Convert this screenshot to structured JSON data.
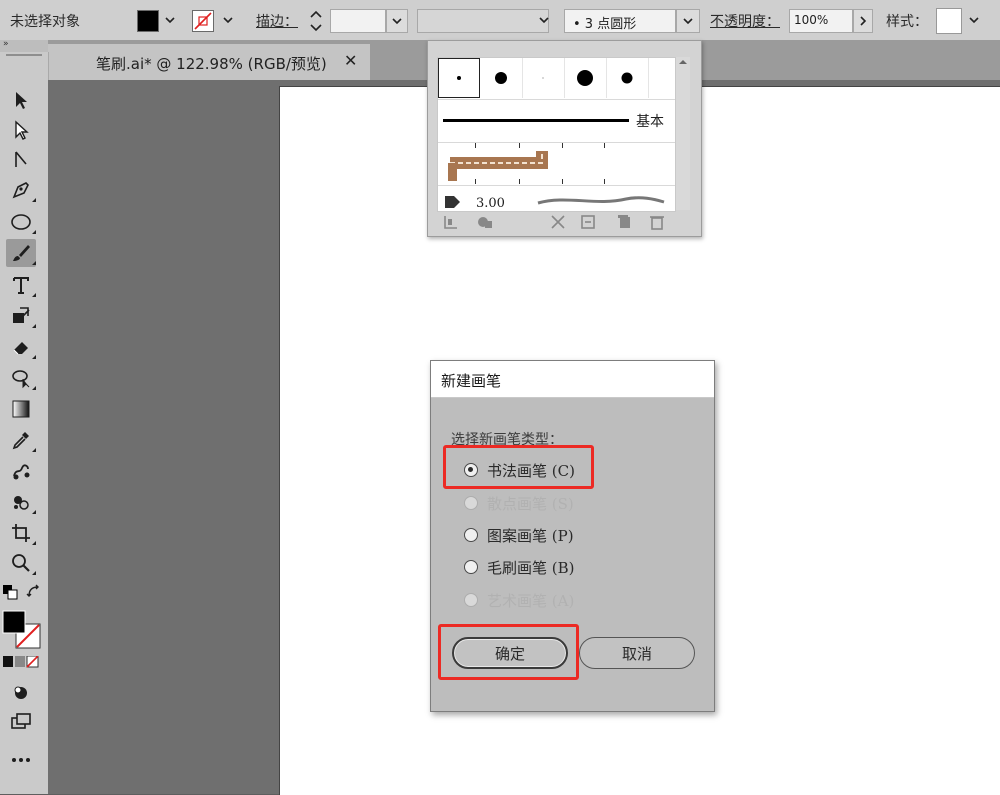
{
  "control_bar": {
    "selection_label": "未选择对象",
    "stroke_label": "描边：",
    "stroke_value": "",
    "brush_value": "•  3  点圆形",
    "opacity_label": "不透明度：",
    "opacity_value": "100%",
    "style_label": "样式："
  },
  "panel_collapse": "»",
  "document_tab": {
    "label": "笔刷.ai* @ 122.98% (RGB/预览)",
    "close": "✕"
  },
  "brush_panel": {
    "basic_label": "基本",
    "partial_value": "3.00"
  },
  "dialog": {
    "title": "新建画笔",
    "prompt": "选择新画笔类型：",
    "options": [
      {
        "label": "书法画笔 (C)",
        "checked": true,
        "disabled": false
      },
      {
        "label": "散点画笔 (S)",
        "checked": false,
        "disabled": true
      },
      {
        "label": "图案画笔 (P)",
        "checked": false,
        "disabled": false
      },
      {
        "label": "毛刷画笔 (B)",
        "checked": false,
        "disabled": false
      },
      {
        "label": "艺术画笔 (A)",
        "checked": false,
        "disabled": true
      }
    ],
    "ok_label": "确定",
    "cancel_label": "取消"
  },
  "colors": {
    "highlight": "#ec2a24",
    "ui_background": "#cfcfcf",
    "canvas": "#6f6f6f",
    "artboard": "#ffffff"
  },
  "icons": {
    "toolbar": [
      "selection-icon",
      "direct-selection-icon",
      "group-selection-icon",
      "pen-icon",
      "ellipse-icon",
      "paintbrush-icon",
      "type-icon",
      "shape-builder-icon",
      "eraser-icon",
      "lasso-icon",
      "gradient-icon",
      "eyedropper-icon",
      "blend-icon",
      "symbol-sprayer-icon",
      "crop-icon",
      "zoom-icon",
      "swap-colors-icon",
      "fill-stroke-icon",
      "color-mode-icon",
      "draw-mode-icon",
      "screen-mode-icon",
      "more-tools-icon"
    ]
  }
}
